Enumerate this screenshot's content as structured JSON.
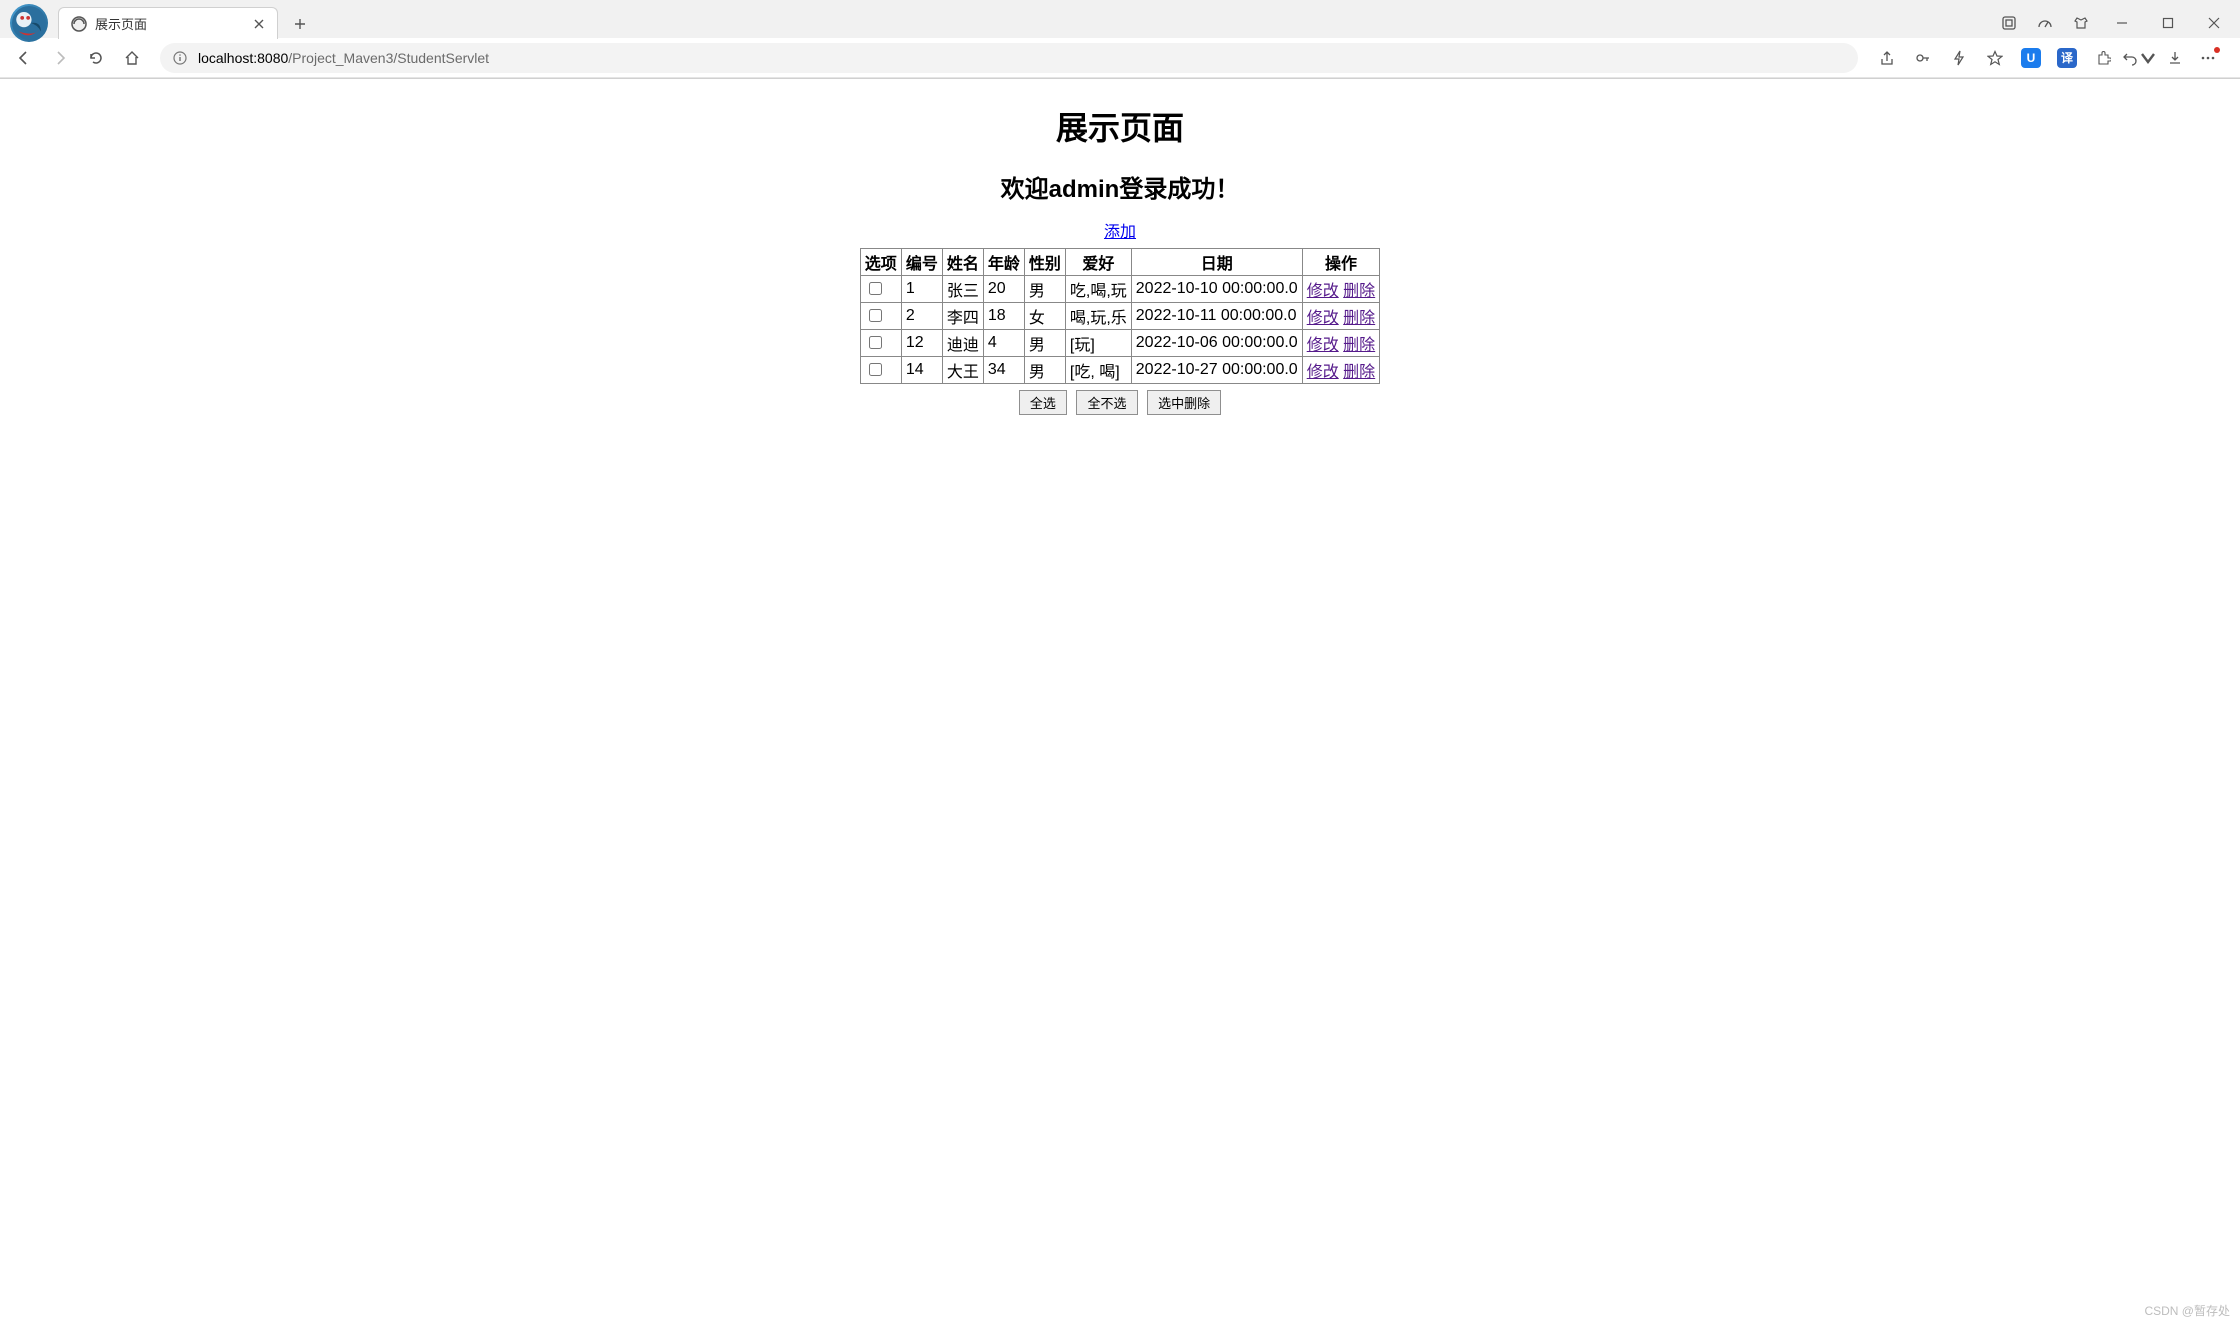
{
  "browser": {
    "tab_title": "展示页面",
    "url_host": "localhost:8080",
    "url_path": "/Project_Maven3/StudentServlet"
  },
  "page": {
    "title": "展示页面",
    "welcome": "欢迎admin登录成功！",
    "add_link": "添加",
    "headers": [
      "选项",
      "编号",
      "姓名",
      "年龄",
      "性别",
      "爱好",
      "日期",
      "操作"
    ],
    "rows": [
      {
        "id": "1",
        "name": "张三",
        "age": "20",
        "gender": "男",
        "hobby": "吃,喝,玩",
        "date": "2022-10-10 00:00:00.0"
      },
      {
        "id": "2",
        "name": "李四",
        "age": "18",
        "gender": "女",
        "hobby": "喝,玩,乐",
        "date": "2022-10-11 00:00:00.0"
      },
      {
        "id": "12",
        "name": "迪迪",
        "age": "4",
        "gender": "男",
        "hobby": "[玩]",
        "date": "2022-10-06 00:00:00.0"
      },
      {
        "id": "14",
        "name": "大王",
        "age": "34",
        "gender": "男",
        "hobby": "[吃, 喝]",
        "date": "2022-10-27 00:00:00.0"
      }
    ],
    "edit_label": "修改",
    "delete_label": "删除",
    "buttons": {
      "select_all": "全选",
      "unselect_all": "全不选",
      "delete_selected": "选中删除"
    }
  },
  "watermark": "CSDN @暂存处"
}
